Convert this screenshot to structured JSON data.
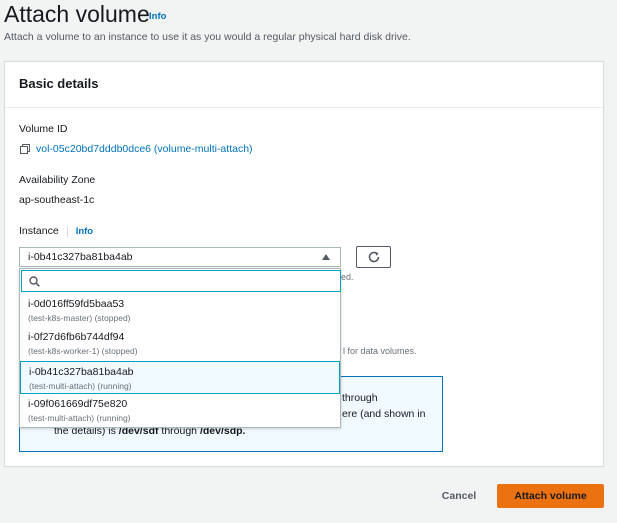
{
  "page": {
    "title": "Attach volume",
    "title_info": "Info",
    "description": "Attach a volume to an instance to use it as you would a regular physical hard disk drive."
  },
  "basic_details": {
    "heading": "Basic details",
    "volume_id_label": "Volume ID",
    "volume_id_value": "vol-05c20bd7dddb0dce6 (volume-multi-attach)",
    "az_label": "Availability Zone",
    "az_value": "ap-southeast-1c",
    "instance_label": "Instance",
    "instance_info": "Info",
    "instance_selected": "i-0b41c327ba81ba4ab",
    "search_placeholder": ""
  },
  "instance_options": [
    {
      "id": "i-0d016ff59fd5baa53",
      "sub": "(test-k8s-master) (stopped)"
    },
    {
      "id": "i-0f27d6fb6b744df94",
      "sub": "(test-k8s-worker-1) (stopped)"
    },
    {
      "id": "i-0b41c327ba81ba4ab",
      "sub": "(test-multi-attach) (running)",
      "selected": true
    },
    {
      "id": "i-09f061669df75e820",
      "sub": "(test-multi-attach) (running)"
    }
  ],
  "background_fragments": {
    "helper_1": "ed.",
    "helper_2": "l for data volumes."
  },
  "info_box": {
    "line1": "through",
    "line2": "ere (and shown in",
    "line3_prefix": "the details) is",
    "line3_from": "/dev/sdf",
    "line3_mid": "through",
    "line3_to": "/dev/sdp."
  },
  "actions": {
    "cancel": "Cancel",
    "attach": "Attach volume"
  },
  "colors": {
    "link": "#0073bb",
    "primary_button": "#ec7211",
    "focus_border": "#00a1c9",
    "selected_bg": "#f1faff"
  }
}
